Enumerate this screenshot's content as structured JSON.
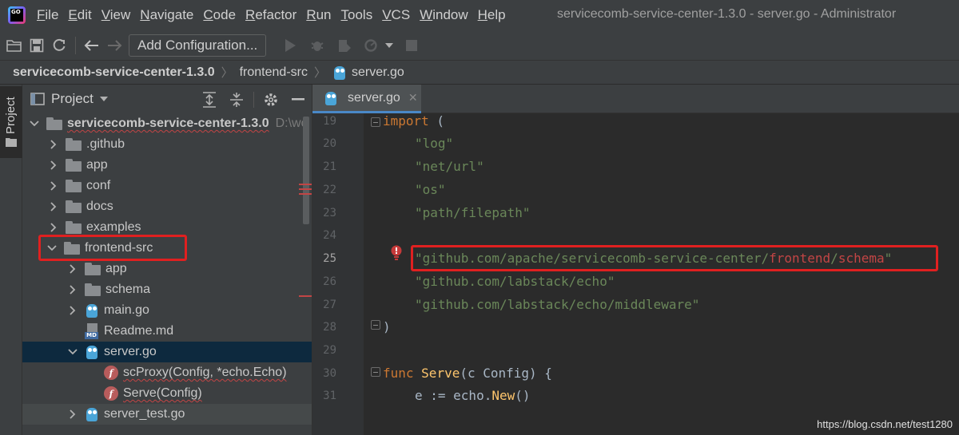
{
  "menubar": {
    "logo_text": "GO",
    "items": [
      "File",
      "Edit",
      "View",
      "Navigate",
      "Code",
      "Refactor",
      "Run",
      "Tools",
      "VCS",
      "Window",
      "Help"
    ],
    "window_title": "servicecomb-service-center-1.3.0 - server.go - Administrator"
  },
  "toolbar": {
    "add_configuration_label": "Add Configuration..."
  },
  "breadcrumb": {
    "items": [
      "servicecomb-service-center-1.3.0",
      "frontend-src",
      "server.go"
    ]
  },
  "side_strip": {
    "project_label": "Project"
  },
  "project_panel": {
    "title": "Project",
    "root": {
      "name": "servicecomb-service-center-1.3.0",
      "path_hint": "D:\\wo"
    },
    "rows": [
      {
        "label": ".github"
      },
      {
        "label": "app"
      },
      {
        "label": "conf"
      },
      {
        "label": "docs"
      },
      {
        "label": "examples"
      },
      {
        "label": "frontend-src"
      },
      {
        "label": "app"
      },
      {
        "label": "schema"
      },
      {
        "label": "main.go"
      },
      {
        "label": "Readme.md"
      },
      {
        "label": "server.go"
      },
      {
        "label": "scProxy(Config, *echo.Echo)"
      },
      {
        "label": "Serve(Config)"
      },
      {
        "label": "server_test.go"
      }
    ]
  },
  "editor": {
    "tab_label": "server.go",
    "line_numbers": [
      "19",
      "20",
      "21",
      "22",
      "23",
      "24",
      "25",
      "26",
      "27",
      "28",
      "29",
      "30",
      "31"
    ],
    "current_line": "25",
    "code": {
      "l19_kw": "import",
      "l19_rest": " (",
      "l20": "\"log\"",
      "l21": "\"net/url\"",
      "l22": "\"os\"",
      "l23": "\"path/filepath\"",
      "l25_a": "\"github.com/apache/servicecomb-service-center/",
      "l25_b": "frontend",
      "l25_c": "/",
      "l25_d": "schema",
      "l25_e": "\"",
      "l26": "\"github.com/labstack/echo\"",
      "l27": "\"github.com/labstack/echo/middleware\"",
      "l28": ")",
      "l30_kw": "func",
      "l30_fn": "Serve",
      "l30_rest": "(c Config) {",
      "l31_a": "e := echo.",
      "l31_fn": "New",
      "l31_b": "()"
    }
  },
  "watermark": "https://blog.csdn.net/test1280",
  "colors": {
    "accent_blue": "#4a88c7",
    "highlight_red": "#e02020",
    "string_green": "#6a8759",
    "keyword_orange": "#cc7832"
  }
}
